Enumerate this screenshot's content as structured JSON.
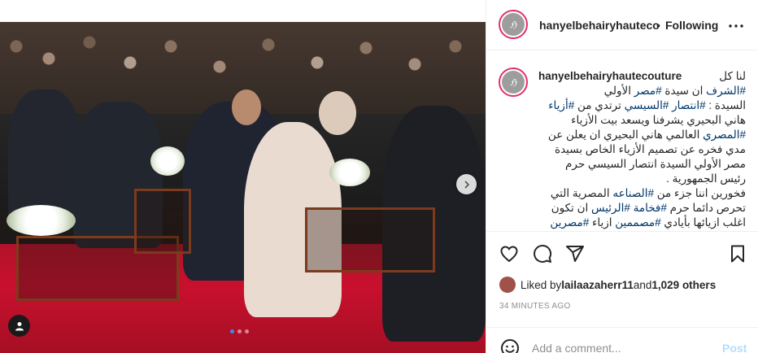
{
  "post": {
    "username": "hanyelbehairyhauteco",
    "separator": "•",
    "follow_status": "Following",
    "more_icon": "more-horizontal-icon"
  },
  "caption": {
    "username": "hanyelbehairyhautecouture",
    "lines": [
      {
        "parts": [
          {
            "t": "لنا كل",
            "tag": false
          }
        ]
      },
      {
        "parts": [
          {
            "t": "#الشرف",
            "tag": true
          },
          {
            "t": " ان سيدة ",
            "tag": false
          },
          {
            "t": "#مصر",
            "tag": true
          },
          {
            "t": " الأولي",
            "tag": false
          }
        ]
      },
      {
        "parts": [
          {
            "t": "السيدة : ",
            "tag": false
          },
          {
            "t": "#انتصار",
            "tag": true
          },
          {
            "t": " ",
            "tag": false
          },
          {
            "t": "#السيسي",
            "tag": true
          },
          {
            "t": " ترتدي من ",
            "tag": false
          },
          {
            "t": "#أزياء",
            "tag": true
          }
        ]
      },
      {
        "parts": [
          {
            "t": "هاني البحيري يشرفنا ويسعد بيت الأزياء",
            "tag": false
          }
        ]
      },
      {
        "parts": [
          {
            "t": "#المصري",
            "tag": true
          },
          {
            "t": " العالمي هاني البحيري ان يعلن عن",
            "tag": false
          }
        ]
      },
      {
        "parts": [
          {
            "t": "مدي فخره عن تصميم الأزياء الخاص بسيدة",
            "tag": false
          }
        ]
      },
      {
        "parts": [
          {
            "t": "مصر الأولي السيدة انتصار السيسي حرم",
            "tag": false
          }
        ]
      },
      {
        "parts": [
          {
            "t": "رئيس الجمهورية .",
            "tag": false
          }
        ]
      },
      {
        "parts": [
          {
            "t": "فخورين اننا جزء من ",
            "tag": false
          },
          {
            "t": "#الصناعه",
            "tag": true
          },
          {
            "t": " المصرية التي",
            "tag": false
          }
        ]
      },
      {
        "parts": [
          {
            "t": "تحرص دائما حرم ",
            "tag": false
          },
          {
            "t": "#فخامة",
            "tag": true
          },
          {
            "t": " ",
            "tag": false
          },
          {
            "t": "#الرئيس",
            "tag": true
          },
          {
            "t": " ان تكون",
            "tag": false
          }
        ]
      },
      {
        "parts": [
          {
            "t": "اغلب ازيائها بأيادي ",
            "tag": false
          },
          {
            "t": "#مصممين",
            "tag": true
          },
          {
            "t": " ازياء ",
            "tag": false
          },
          {
            "t": "#مصرين",
            "tag": true
          }
        ]
      }
    ]
  },
  "actions": {
    "like_icon": "heart-icon",
    "comment_icon": "comment-icon",
    "share_icon": "share-icon",
    "save_icon": "bookmark-icon"
  },
  "likes": {
    "prefix": "Liked by ",
    "user": "lailaazaherr11",
    "middle": " and ",
    "count": "1,029 others"
  },
  "timestamp": "34 MINUTES AGO",
  "comment": {
    "placeholder": "Add a comment...",
    "post_label": "Post",
    "emoji_icon": "smiley-icon"
  },
  "carousel": {
    "total": 3,
    "active_index": 0,
    "next_icon": "chevron-right-icon",
    "tag_icon": "user-tag-icon"
  },
  "colors": {
    "hashtag": "#00376b",
    "story_ring": "#e1306c",
    "post_disabled": "#b2dffc",
    "active_dot": "#2f95dc",
    "muted": "#8e8e8e"
  }
}
